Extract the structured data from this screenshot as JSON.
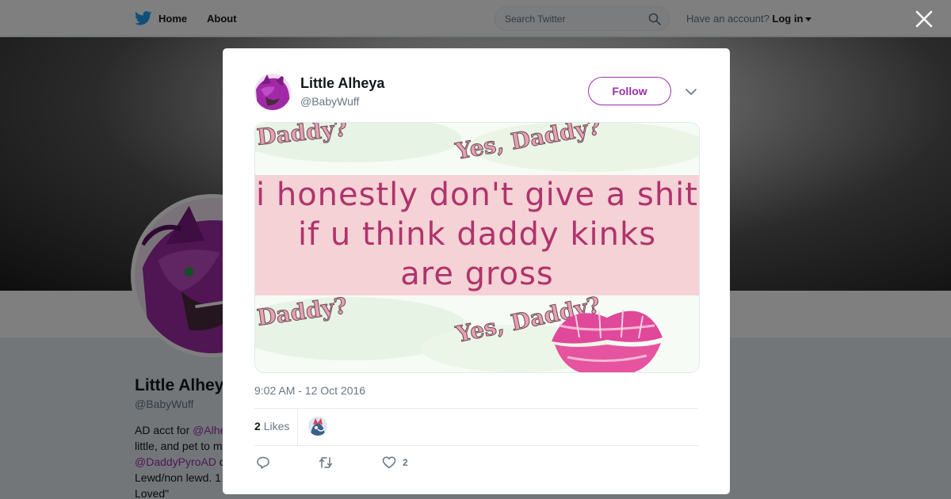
{
  "topbar": {
    "home_label": "Home",
    "about_label": "About",
    "search_placeholder": "Search Twitter",
    "account_prompt": "Have an account?",
    "login_label": "Log in"
  },
  "profile": {
    "name": "Little Alhey",
    "handle": "@BabyWuff",
    "bio": {
      "line1_prefix": "AD acct for ",
      "line1_mention": "@Alhe",
      "line2": "little, and pet to m",
      "line3_mention": "@DaddyPyroAD",
      "line3_suffix": " o",
      "line4": "Lewd/non lewd. 1",
      "line5": "Loved\""
    }
  },
  "tweet": {
    "author_name": "Little Alheya",
    "author_handle": "@BabyWuff",
    "follow_label": "Follow",
    "media_text": {
      "line1": "i honestly don't give a shit",
      "line2": "if u think daddy kinks",
      "line3": "are gross",
      "sticker1": "Daddy?",
      "sticker2": "Yes, Daddy?",
      "sticker3": "Daddy?",
      "sticker4": "Yes, Daddy?"
    },
    "timestamp": "9:02 AM - 12 Oct 2016",
    "likes_count": "2",
    "likes_label": "Likes",
    "action_like_count": "2"
  },
  "icons": {
    "brand": "twitter-bird-icon",
    "search": "search-icon",
    "close": "close-icon",
    "more": "chevron-down-icon",
    "reply": "reply-icon",
    "retweet": "retweet-icon",
    "like": "heart-icon"
  },
  "colors": {
    "brand_blue": "#1da1f2",
    "accent_purple": "#9b2fae",
    "muted_text": "#657786"
  }
}
